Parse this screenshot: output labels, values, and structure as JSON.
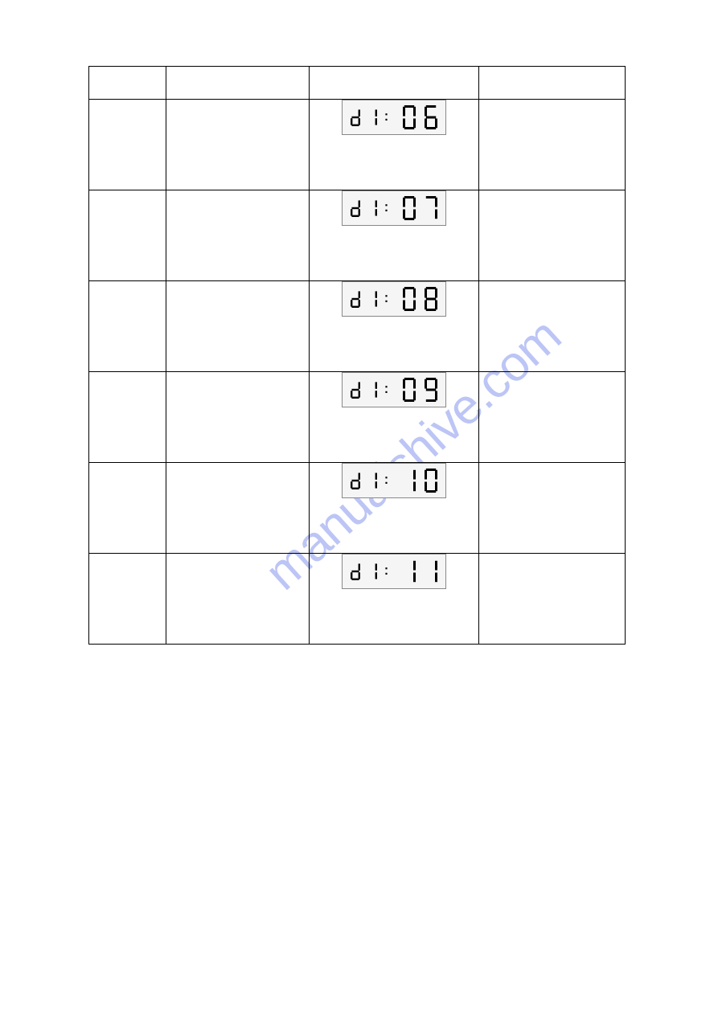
{
  "watermark": "manualshive.com",
  "rows": [
    {
      "prefix": "d1",
      "value": "06"
    },
    {
      "prefix": "d1",
      "value": "07"
    },
    {
      "prefix": "d1",
      "value": "08"
    },
    {
      "prefix": "d1",
      "value": "09"
    },
    {
      "prefix": "d1",
      "value": "10"
    },
    {
      "prefix": "d1",
      "value": "11"
    }
  ]
}
